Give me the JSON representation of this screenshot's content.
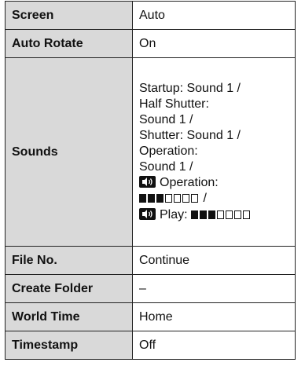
{
  "rows": [
    {
      "label": "Screen",
      "value": "Auto"
    },
    {
      "label": "Auto Rotate",
      "value": "On"
    },
    {
      "label": "Sounds",
      "lines": [
        "Startup: Sound 1 /",
        "Half Shutter:",
        "Sound 1 /",
        "Shutter: Sound 1 /",
        "Operation:",
        "Sound 1 /"
      ],
      "operation_label": "Operation:",
      "operation_suffix": "/",
      "play_label": "Play:",
      "operation_volume": {
        "filled": 3,
        "total": 7
      },
      "play_volume": {
        "filled": 3,
        "total": 7
      },
      "icon": "speaker-icon"
    },
    {
      "label": "File No.",
      "value": "Continue"
    },
    {
      "label": "Create Folder",
      "value": "–"
    },
    {
      "label": "World Time",
      "value": "Home"
    },
    {
      "label": "Timestamp",
      "value": "Off"
    }
  ]
}
